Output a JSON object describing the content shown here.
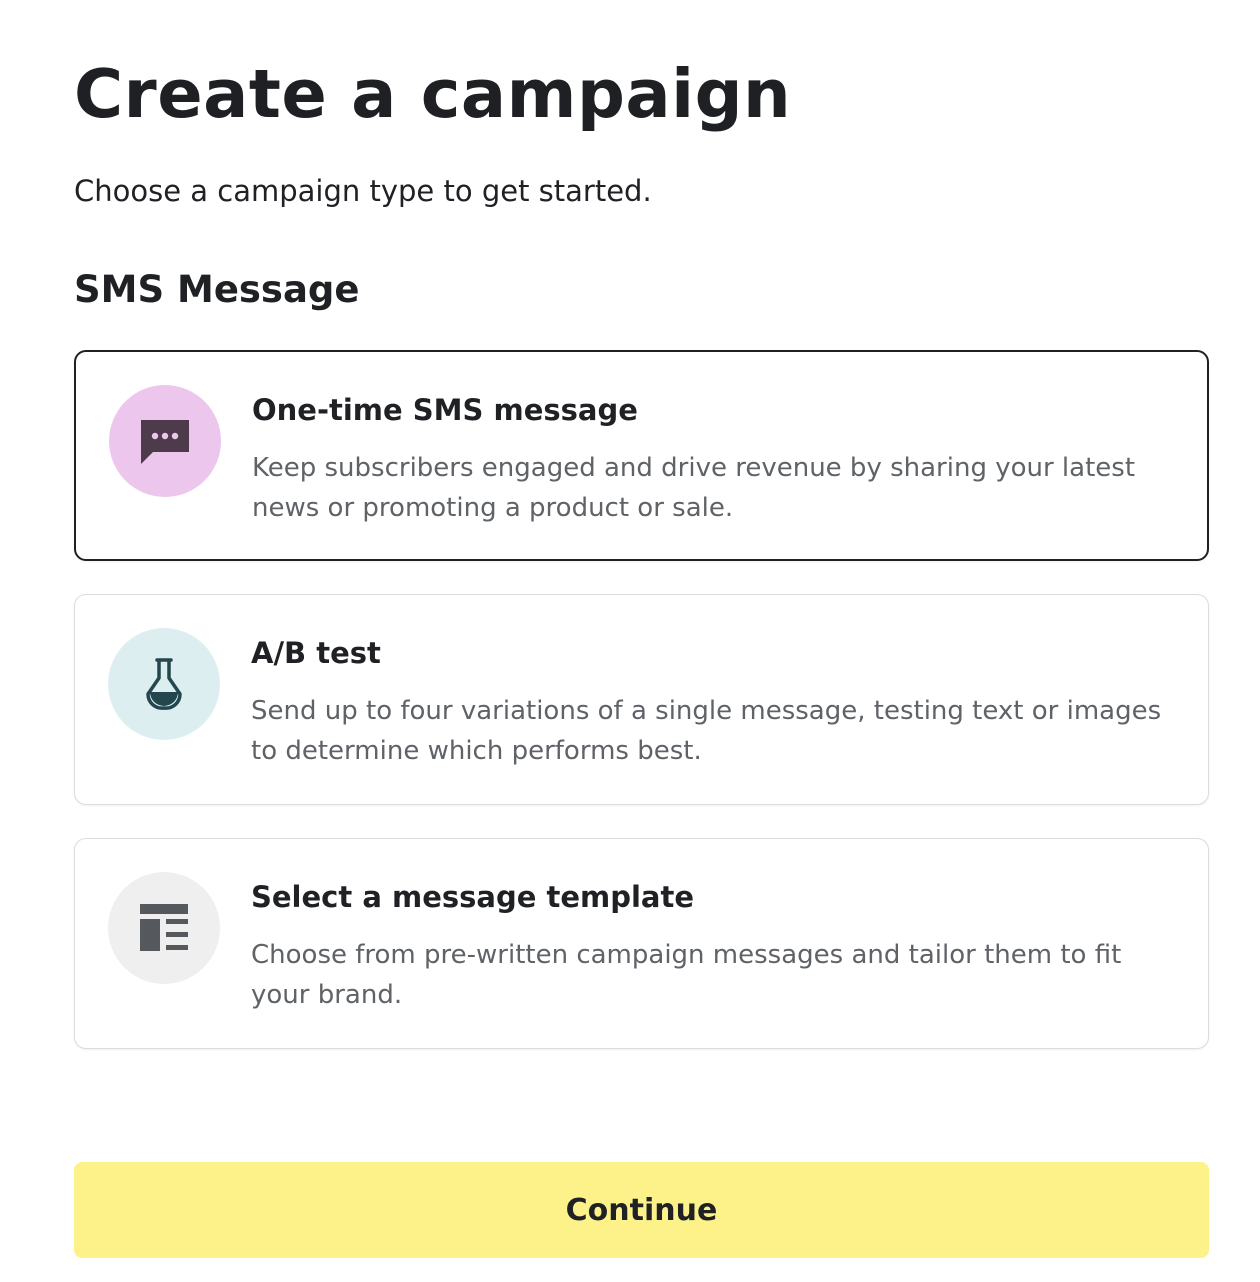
{
  "page": {
    "title": "Create a campaign",
    "subtitle": "Choose a campaign type to get started."
  },
  "section": {
    "title": "SMS Message"
  },
  "options": [
    {
      "title": "One-time SMS message",
      "description": "Keep subscribers engaged and drive revenue by sharing your latest news or promoting a product or sale.",
      "icon": "chat-bubble-icon",
      "selected": true
    },
    {
      "title": "A/B test",
      "description": "Send up to four variations of a single message, testing text or images to determine which performs best.",
      "icon": "flask-icon",
      "selected": false
    },
    {
      "title": "Select a message template",
      "description": "Choose from pre-written campaign messages and tailor them to fit your brand.",
      "icon": "template-icon",
      "selected": false
    }
  ],
  "actions": {
    "continue_label": "Continue"
  },
  "colors": {
    "accent_button": "#fdf28a",
    "selected_border": "#1f2125",
    "sms_icon_bg": "#ecc6ec",
    "ab_icon_bg": "#ddeef1",
    "template_icon_bg": "#efefef"
  }
}
